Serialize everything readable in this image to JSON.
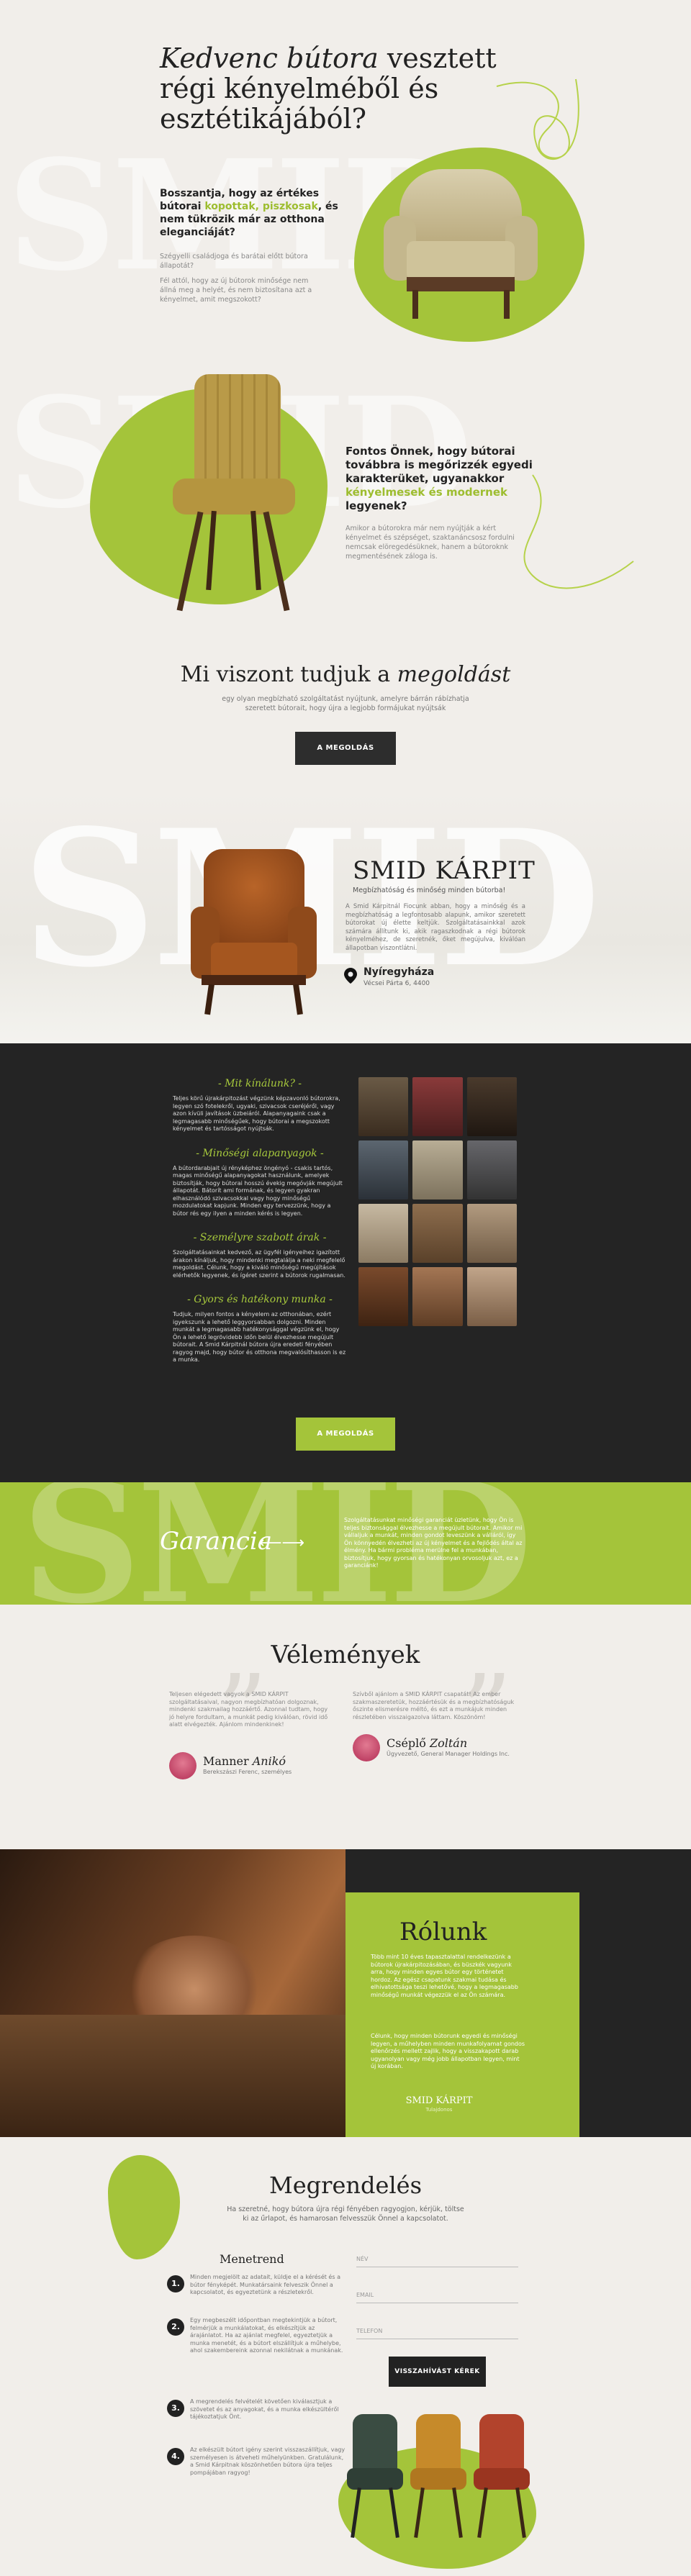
{
  "hero": {
    "title_em": "Kedvenc bútora",
    "title_rest": " vesztett régi kényelméből és esztétikájából?",
    "background_word": "SMID",
    "problem1": {
      "heading_a": "Bosszantja, hogy az értékes bútorai ",
      "heading_green": "kopottak, piszkosak",
      "heading_b": ", és nem tükrözik már az otthona eleganciáját?",
      "text1": "Szégyelli családjoga és barátai előtt bútora állapotát?",
      "text2": "Fél attól, hogy az új bútorok minősége nem állná meg a helyét, és nem biztosítana azt a kényelmet, amit megszokott?"
    },
    "problem2": {
      "heading_a": "Fontos Önnek, hogy bútorai továbbra is megőrizzék egyedi karakterüket, ugyanakkor ",
      "heading_green": "kényelmesek és modernek",
      "heading_b": " legyenek?",
      "text": "Amikor a bútorokra már nem nyújtják a kért kényelmet és szépséget, szaktanáncsosz fordulni nemcsak elöregedésüknek, hanem a bútoroknk megmentésének záloga is."
    }
  },
  "solution": {
    "title_a": "Mi viszont tudjuk a ",
    "title_em": "megoldást",
    "text": "egy olyan megbízható szolgáltatást nyújtunk, amelyre bárrán rábízhatja szeretett bútorait, hogy újra a legjobb formájukat nyújtsák",
    "button": "A MEGOLDÁS"
  },
  "smid": {
    "background_word": "SMID",
    "title": "SMID KÁRPIT",
    "subtitle": "Megbízhatóság és minőség minden bútorba!",
    "text": "A Smid Kárpitnál Fiocunk abban, hogy a minőség és a megbízhatóság a legfontosabb alapunk, amikor szeretett bútorokat új élette keltjük. Szolgáltatásainkkal azok számára állítunk ki, akik ragaszkodnak a régi bútorok kényelméhez, de szeretnék, őket megújulva, kiválóan állapotban viszontlátni.",
    "city": "Nyíregyháza",
    "address": "Vécsei Párta 6, 4400"
  },
  "offer": {
    "features": [
      {
        "title": "- Mit kínálunk? -",
        "text": "Teljes körű újrakárpitozást végzünk képzavonló bútorokra, legyen szó fotelekről, ugyaki, szivacsok cseréjéről, vagy azon kívüli javítások üzbeiáról. Alapanyagaink csak a legmagasabb minőségűek, hogy bútorai a megszokott kényelmet és tartósságot nyújtsák."
      },
      {
        "title": "- Minőségi alapanyagok -",
        "text": "A bútordarabjait új rényképhez öngényó - csakis tartós, magas minőségű alapanyagokat használunk, amelyek biztosítják, hogy bútorai hosszú évekig megóvják megújult állapotát. Bátorít ami formának, és legyen gyakran elhasználódó szivacsokkal vagy hogy minőségű mozdulatokat kapjunk. Minden egy tervezzünk, hogy a bútor rés egy ilyen a minden kérés is legyen."
      },
      {
        "title": "- Személyre szabott árak -",
        "text": "Szolgáltatásainkat kedvező, az ügyfél igényeihez igazított árakon kínáljuk, hogy mindenki megtalálja a neki megfelelő megoldást. Célunk, hogy a kiváló minőségű megújítások elérhetők legyenek, és ígéret szerint a bútorok rugalmasan."
      },
      {
        "title": "- Gyors és hatékony munka -",
        "text": "Tudjuk, milyen fontos a kényelem az otthonában, ezért igyekszunk a lehető leggyorsabban dolgozni. Minden munkát a legmagasabb hatékonysággal végzünk el, hogy Ön a lehető legrövidebb időn belül élvezhesse megújult bútorait. A Smid Kárpitnál bútora újra eredeti fényében ragyog majd, hogy bútor és otthona megvalósíthasson is ez a munka."
      }
    ],
    "button": "A MEGOLDÁS"
  },
  "guarantee": {
    "title": "Garancia",
    "arrow": "⟵⟶",
    "text": "Szolgáltatásunkat minőségi garanciát üzletünk, hogy Ön is teljes biztonsággal élvezhesse a megújult bútorait. Amikor mi vállaljuk a munkát, minden gondot leveszünk a válláról, így Ön könnyedén élvezheti az új kényelmet és a fejlődés által az élmény. Ha bármi probléma merülne fel a munkában, biztosítjuk, hogy gyorsan és hatékonyan orvosoljuk azt, ez a garanciánk!"
  },
  "reviews": {
    "title": "Vélemények",
    "items": [
      {
        "text": "Teljesen elégedett vagyok a SMID KÁRPIT szolgáltatásaival, nagyon megbízhatóan dolgoznak, mindenki szakmailag hozzáértő. Azonnal tudtam, hogy jó helyre fordultam, a munkát pedig kiválóan, rövid idő alatt elvégezték. Ajánlom mindenkinek!",
        "name_a": "Manner ",
        "name_em": "Anikó",
        "role": "Berekszászi Ferenc, személyes"
      },
      {
        "text": "Szívből ajánlom a SMID KÁRPIT csapatát! Az ember szakmaszeretetük, hozzáértésük és a megbízhatóságuk őszinte elismerésre méltó, és ezt a munkájuk minden részletében visszaigazolva láttam. Köszönöm!",
        "name_a": "Cséplő ",
        "name_em": "Zoltán",
        "role": "Ügyvezető, General Manager Holdings Inc."
      }
    ]
  },
  "about": {
    "title": "Rólunk",
    "text1": "Több mint 10 éves tapasztalattal rendelkezünk a bútorok újrakárpitozásában, és büszkék vagyunk arra, hogy minden egyes bútor egy történetet hordoz. Az egész csapatunk szakmai tudása és elhivatottsága teszi lehetővé, hogy a legmagasabb minőségű munkát végezzük el az Ön számára.",
    "text2": "Célunk, hogy minden bútorunk egyedi és minőségi legyen, a műhelyben minden munkafolyamat gondos ellenőrzés mellett zajlik, hogy a visszakapott darab ugyanolyan vagy még jobb állapotban legyen, mint új korában.",
    "signature": "SMID KÁRPIT",
    "signature_sub": "Tulajdonos"
  },
  "order": {
    "title": "Megrendelés",
    "subtitle": "Ha szeretné, hogy bútora újra régi fényében ragyogjon, kérjük, töltse ki az űrlapot, és hamarosan felvesszük Önnel a kapcsolatot.",
    "process_title": "Menetrend",
    "steps": [
      {
        "num": "1.",
        "text": "Minden megjelölt az adatait, küldje el a kérését és a bútor fényképét. Munkatársaink felveszik Önnel a kapcsolatot, és egyeztetünk a részletekről."
      },
      {
        "num": "2.",
        "text": "Egy megbeszélt időpontban megtekintjük a bútort, felmérjük a munkálatokat, és elkészítjük az árajánlatot. Ha az ajánlat megfelel, egyeztetjük a munka menetét, és a bútort elszállítjuk a műhelybe, ahol szakembereink azonnal nekilátnak a munkának."
      },
      {
        "num": "3.",
        "text": "A megrendelés felvételét követően kiválasztjuk a szövetet és az anyagokat, és a munka elkészültéről tájékoztatjuk Önt."
      },
      {
        "num": "4.",
        "text": "Az elkészült bútort igény szerint visszaszállítjuk, vagy személyesen is átveheti műhelyünkben. Gratulálunk, a Smid Kárpitnak köszönhetően bútora újra teljes pompájában ragyog!"
      }
    ],
    "form": {
      "name": "NÉV",
      "email": "EMAIL",
      "phone": "TELEFON",
      "button": "VISSZAHÍVÁST KÉREK"
    }
  },
  "colors": {
    "accent": "#a4c43a",
    "dark": "#242424",
    "cream": "#f1eeea"
  }
}
